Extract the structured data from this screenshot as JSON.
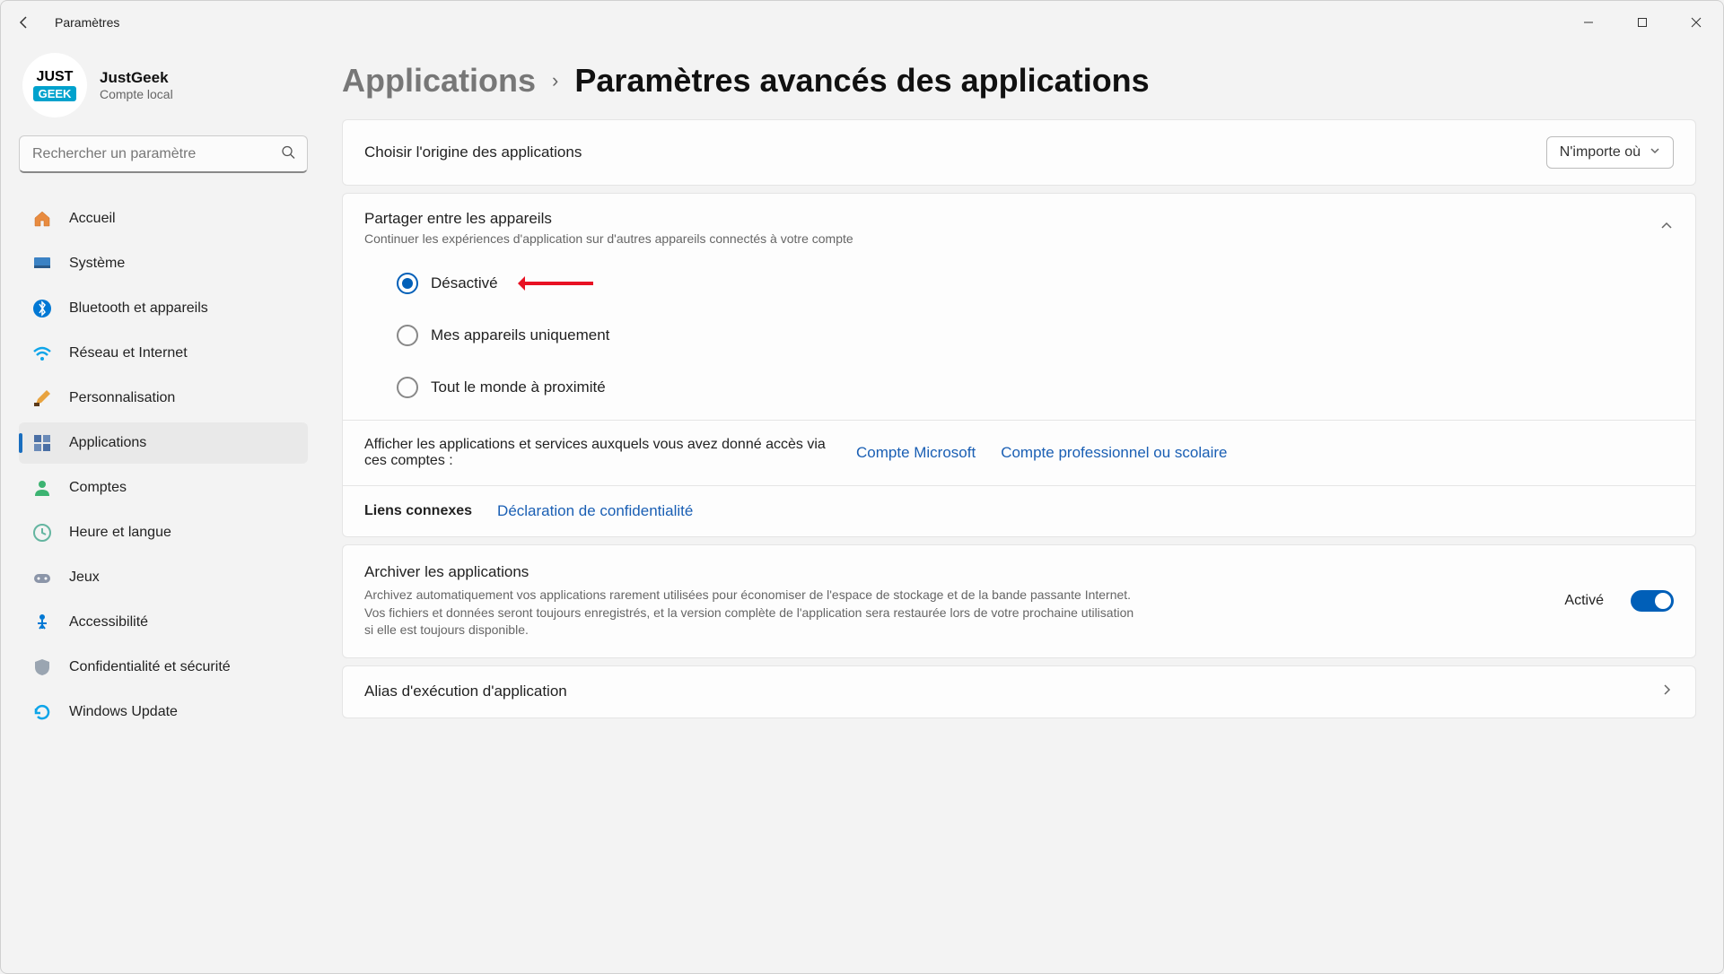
{
  "window": {
    "title": "Paramètres"
  },
  "profile": {
    "name": "JustGeek",
    "account": "Compte local",
    "avatar_line1": "JUST",
    "avatar_line2": "GEEK"
  },
  "search": {
    "placeholder": "Rechercher un paramètre"
  },
  "nav": {
    "items": [
      {
        "label": "Accueil",
        "icon": "home"
      },
      {
        "label": "Système",
        "icon": "system"
      },
      {
        "label": "Bluetooth et appareils",
        "icon": "bluetooth"
      },
      {
        "label": "Réseau et Internet",
        "icon": "wifi"
      },
      {
        "label": "Personnalisation",
        "icon": "brush"
      },
      {
        "label": "Applications",
        "icon": "apps",
        "active": true
      },
      {
        "label": "Comptes",
        "icon": "person"
      },
      {
        "label": "Heure et langue",
        "icon": "clock"
      },
      {
        "label": "Jeux",
        "icon": "games"
      },
      {
        "label": "Accessibilité",
        "icon": "access"
      },
      {
        "label": "Confidentialité et sécurité",
        "icon": "shield"
      },
      {
        "label": "Windows Update",
        "icon": "update"
      }
    ]
  },
  "breadcrumb": {
    "parent": "Applications",
    "sep": "›",
    "current": "Paramètres avancés des applications"
  },
  "sections": {
    "source": {
      "title": "Choisir l'origine des applications",
      "value": "N'importe où"
    },
    "share": {
      "title": "Partager entre les appareils",
      "subtitle": "Continuer les expériences d'application sur d'autres appareils connectés à votre compte",
      "options": [
        {
          "label": "Désactivé",
          "selected": true
        },
        {
          "label": "Mes appareils uniquement",
          "selected": false
        },
        {
          "label": "Tout le monde à proximité",
          "selected": false
        }
      ]
    },
    "access": {
      "label": "Afficher les applications et services auxquels vous avez donné accès via ces comptes :",
      "link1": "Compte Microsoft",
      "link2": "Compte professionnel ou scolaire"
    },
    "related": {
      "title": "Liens connexes",
      "link": "Déclaration de confidentialité"
    },
    "archive": {
      "title": "Archiver les applications",
      "desc": "Archivez automatiquement vos applications rarement utilisées pour économiser de l'espace de stockage et de la bande passante Internet. Vos fichiers et données seront toujours enregistrés, et la version complète de l'application sera restaurée lors de votre prochaine utilisation si elle est toujours disponible.",
      "state": "Activé",
      "on": true
    },
    "alias": {
      "title": "Alias d'exécution d'application"
    }
  }
}
